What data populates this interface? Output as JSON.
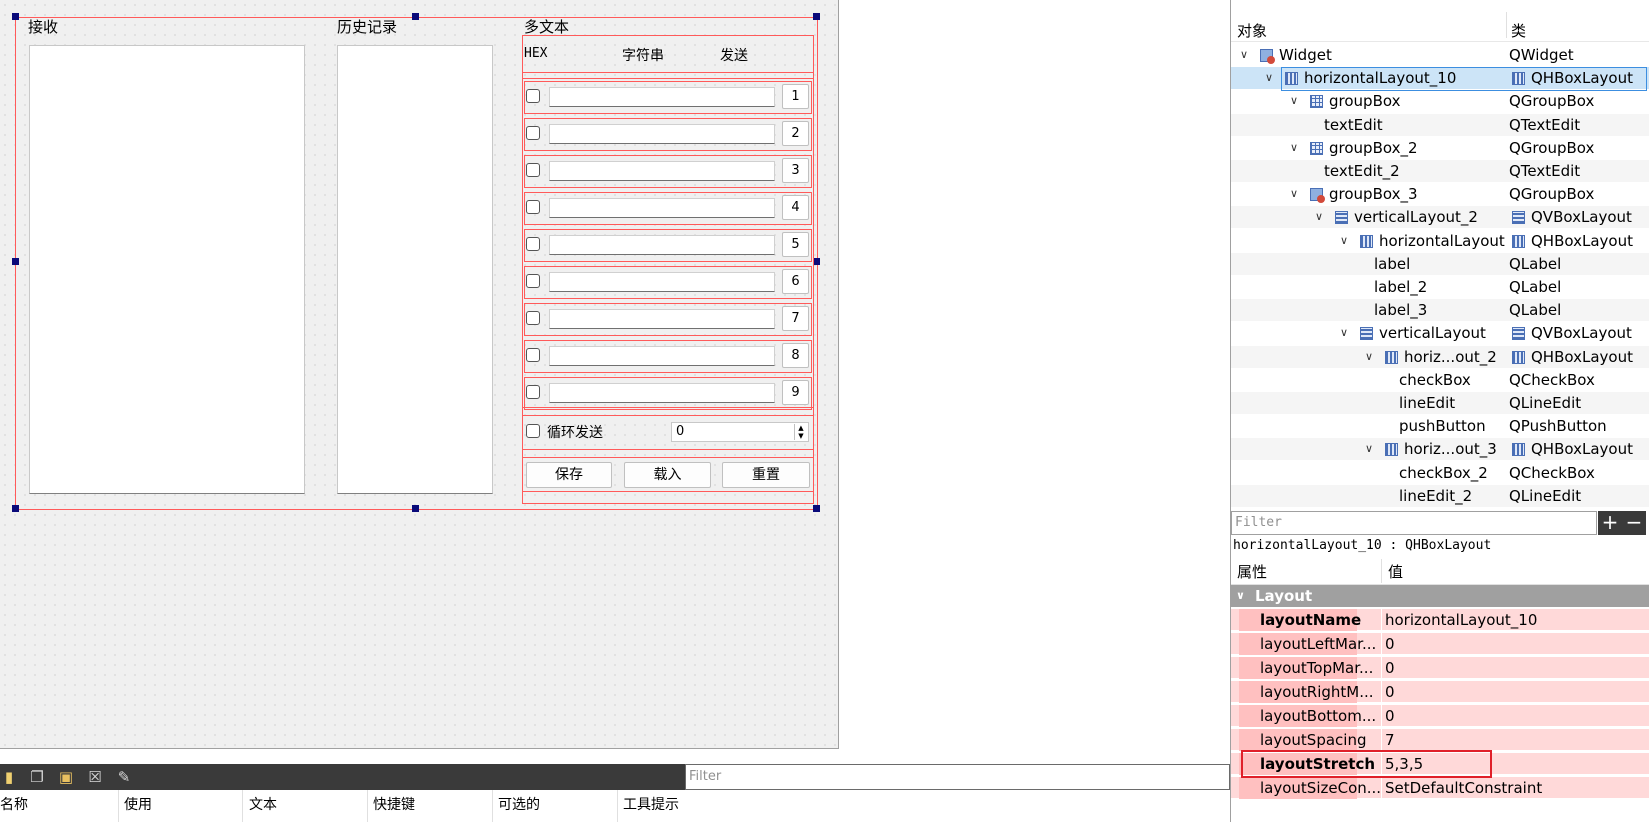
{
  "designer": {
    "group_titles": [
      "接收",
      "历史记录",
      "多文本"
    ],
    "header_labels": [
      "HEX",
      "字符串",
      "发送"
    ],
    "send_rows": [
      "1",
      "2",
      "3",
      "4",
      "5",
      "6",
      "7",
      "8",
      "9"
    ],
    "loop_send_label": "循环发送",
    "spin_value": "0",
    "buttons": [
      "保存",
      "载入",
      "重置"
    ]
  },
  "bottom": {
    "filter_placeholder": "Filter",
    "columns": [
      "名称",
      "使用",
      "文本",
      "快捷键",
      "可选的",
      "工具提示"
    ],
    "toolbar_icons": [
      "new-action-icon",
      "copy-icon",
      "open-icon",
      "delete-icon",
      "configure-icon"
    ]
  },
  "object_inspector": {
    "headers": {
      "object": "对象",
      "class": "类"
    },
    "items": [
      {
        "name": "Widget",
        "class": "QWidget"
      },
      {
        "name": "horizontalLayout_10",
        "class": "QHBoxLayout"
      },
      {
        "name": "groupBox",
        "class": "QGroupBox"
      },
      {
        "name": "textEdit",
        "class": "QTextEdit"
      },
      {
        "name": "groupBox_2",
        "class": "QGroupBox"
      },
      {
        "name": "textEdit_2",
        "class": "QTextEdit"
      },
      {
        "name": "groupBox_3",
        "class": "QGroupBox"
      },
      {
        "name": "verticalLayout_2",
        "class": "QVBoxLayout"
      },
      {
        "name": "horizontalLayout",
        "class": "QHBoxLayout"
      },
      {
        "name": "label",
        "class": "QLabel"
      },
      {
        "name": "label_2",
        "class": "QLabel"
      },
      {
        "name": "label_3",
        "class": "QLabel"
      },
      {
        "name": "verticalLayout",
        "class": "QVBoxLayout"
      },
      {
        "name": "horiz...out_2",
        "class": "QHBoxLayout"
      },
      {
        "name": "checkBox",
        "class": "QCheckBox"
      },
      {
        "name": "lineEdit",
        "class": "QLineEdit"
      },
      {
        "name": "pushButton",
        "class": "QPushButton"
      },
      {
        "name": "horiz...out_3",
        "class": "QHBoxLayout"
      },
      {
        "name": "checkBox_2",
        "class": "QCheckBox"
      },
      {
        "name": "lineEdit_2",
        "class": "QLineEdit"
      }
    ]
  },
  "property_editor": {
    "filter_placeholder": "Filter",
    "add_button": "+",
    "remove_button": "−",
    "object_line": "horizontalLayout_10 : QHBoxLayout",
    "headers": {
      "property": "属性",
      "value": "值"
    },
    "section": "Layout",
    "properties": [
      {
        "name": "layoutName",
        "value": "horizontalLayout_10"
      },
      {
        "name": "layoutLeftMar...",
        "value": "0"
      },
      {
        "name": "layoutTopMar...",
        "value": "0"
      },
      {
        "name": "layoutRightM...",
        "value": "0"
      },
      {
        "name": "layoutBottom...",
        "value": "0"
      },
      {
        "name": "layoutSpacing",
        "value": "7"
      },
      {
        "name": "layoutStretch",
        "value": "5,3,5"
      },
      {
        "name": "layoutSizeCon...",
        "value": "SetDefaultConstraint"
      }
    ]
  },
  "colors": {
    "layout_outline": "#ff5a5a",
    "selection": "#cce4f7",
    "property_row": "#ffd9d9",
    "highlight_box": "#e0202a"
  }
}
